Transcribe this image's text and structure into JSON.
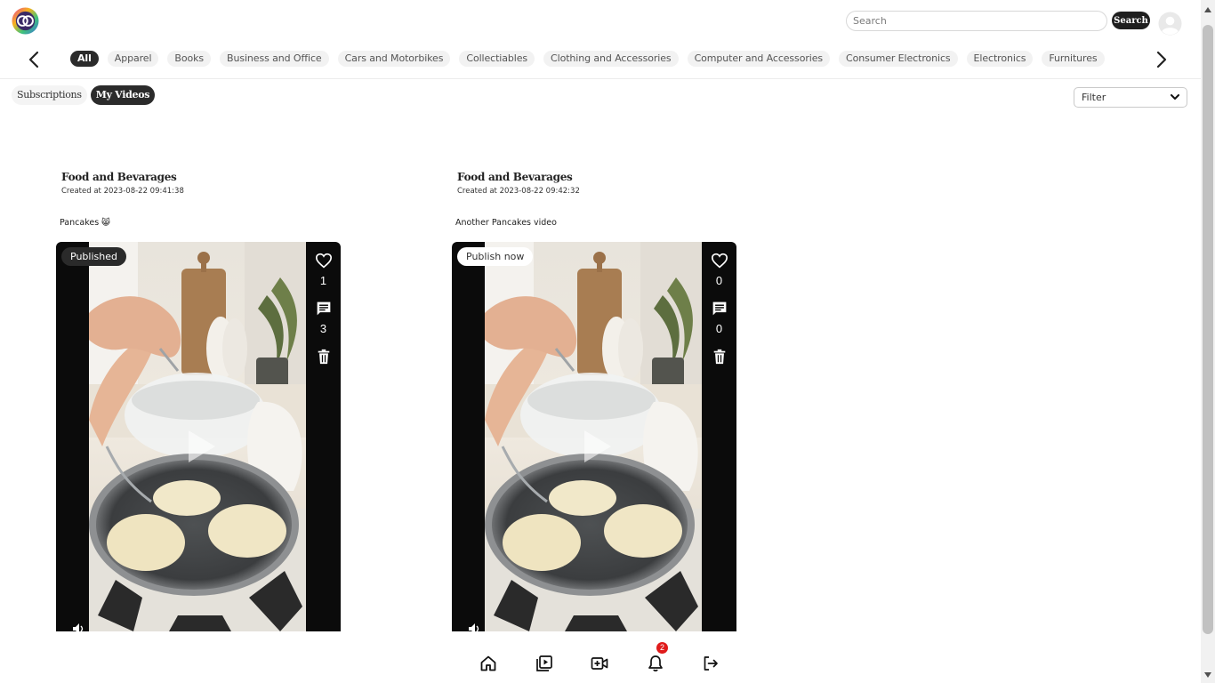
{
  "header": {
    "logo_icon": "overlapping-rings-logo",
    "search_placeholder": "Search",
    "search_button": "Search",
    "avatar_icon": "user-avatar-icon"
  },
  "categories": [
    "All",
    "Apparel",
    "Books",
    "Business and Office",
    "Cars and Motorbikes",
    "Collectiables",
    "Clothing and Accessories",
    "Computer and Accessories",
    "Consumer Electronics",
    "Electronics",
    "Furnitures"
  ],
  "active_category": "All",
  "tabs": {
    "subscriptions": "Subscriptions",
    "my_videos": "My Videos"
  },
  "active_tab": "My Videos",
  "filter": {
    "selected": "Filter"
  },
  "videos": [
    {
      "title": "Food and Bevarages",
      "created": "Created at 2023-08-22 09:41:38",
      "description": "Pancakes 😸",
      "status": "Published",
      "likes": "1",
      "comments": "3"
    },
    {
      "title": "Food and Bevarages",
      "created": "Created at 2023-08-22 09:42:32",
      "description": "Another Pancakes video",
      "status": "Publish now",
      "likes": "0",
      "comments": "0"
    }
  ],
  "bottom_nav": {
    "icons": [
      "home-icon",
      "video-library-icon",
      "add-video-icon",
      "bell-icon",
      "logout-icon"
    ],
    "notification_count": "2"
  },
  "colors": {
    "accent_dark": "#2b2b2b",
    "badge": "#e01b1b",
    "player_bg": "#0b0b0b"
  }
}
